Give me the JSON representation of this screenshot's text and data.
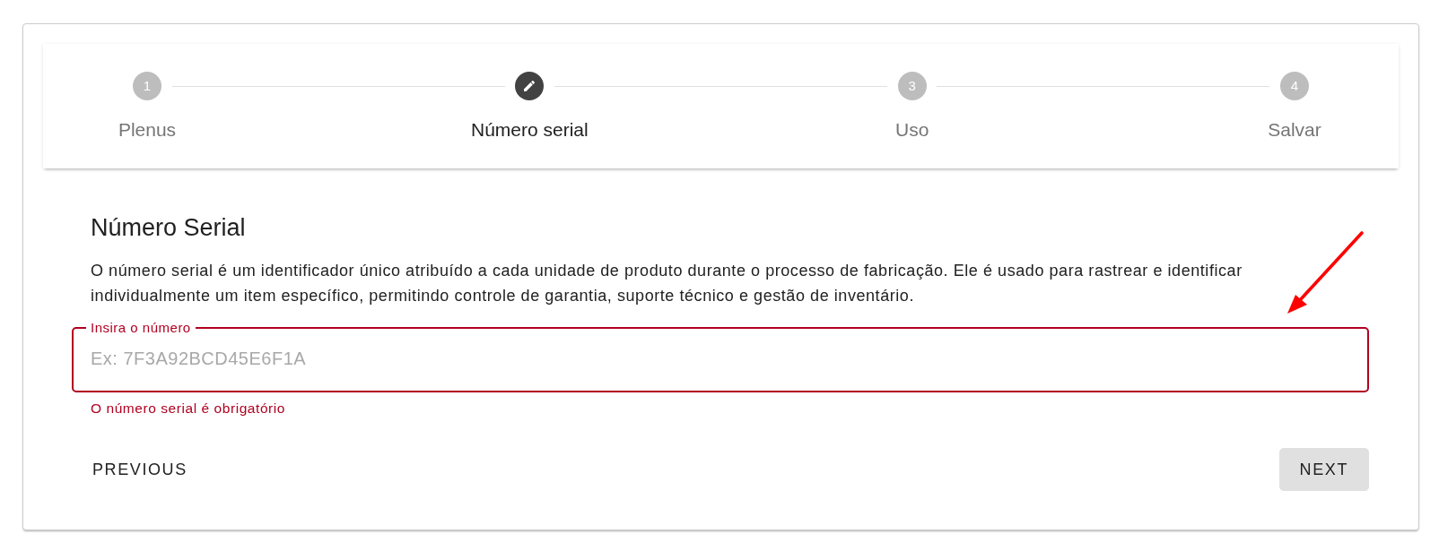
{
  "stepper": {
    "steps": [
      {
        "number": "1",
        "label": "Plenus",
        "selected": false
      },
      {
        "label": "Número serial",
        "selected": true
      },
      {
        "number": "3",
        "label": "Uso",
        "selected": false
      },
      {
        "number": "4",
        "label": "Salvar",
        "selected": false
      }
    ]
  },
  "section": {
    "title": "Número Serial",
    "description": "O número serial é um identificador único atribuído a cada unidade de produto durante o processo de fabricação. Ele é usado para rastrear e identificar individualmente um item específico, permitindo controle de garantia, suporte técnico e gestão de inventário."
  },
  "field": {
    "label": "Insira o número",
    "placeholder": "Ex: 7F3A92BCD45E6F1A",
    "invalid": true,
    "message": "O número serial é obrigatório"
  },
  "buttons": [
    {
      "label": "PREVIOUS",
      "kind": "text"
    },
    {
      "label": "NEXT",
      "kind": "filled"
    }
  ]
}
